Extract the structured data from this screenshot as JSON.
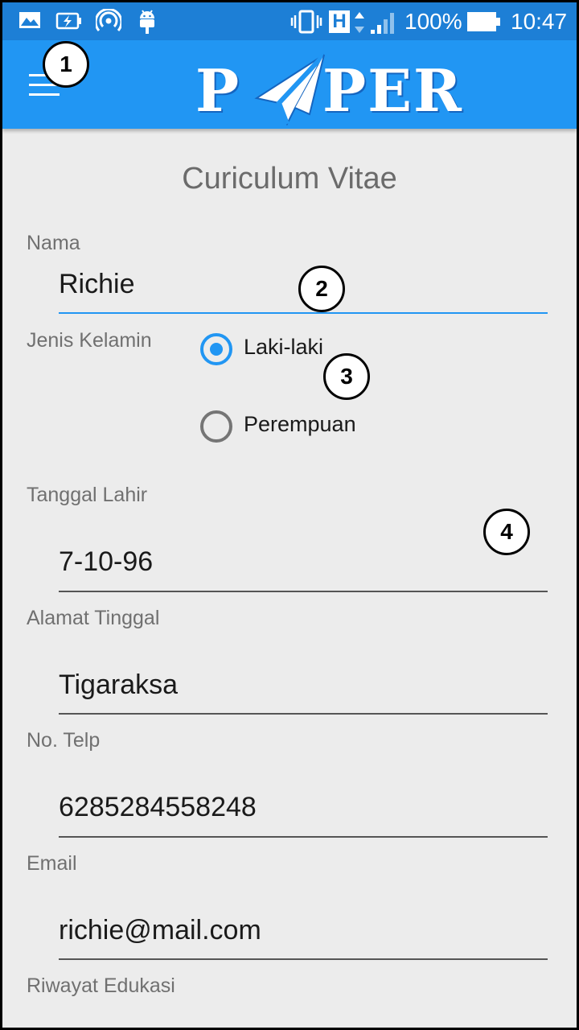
{
  "status_bar": {
    "battery_percent": "100%",
    "time": "10:47",
    "network_type": "H",
    "icons": [
      "image-notification-icon",
      "battery-charging-icon",
      "hotspot-icon",
      "android-icon",
      "vibrate-icon",
      "network-type-icon",
      "signal-icon",
      "battery-icon"
    ]
  },
  "app_bar": {
    "logo_text_left": "P",
    "logo_text_right": "PER",
    "menu_icon": "hamburger-menu-icon",
    "accent_color": "#2196f3"
  },
  "callouts": [
    "1",
    "2",
    "3",
    "4"
  ],
  "form": {
    "title": "Curiculum Vitae",
    "nama": {
      "label": "Nama",
      "value": "Richie"
    },
    "jenis_kelamin": {
      "label": "Jenis Kelamin",
      "options": [
        {
          "label": "Laki-laki",
          "checked": true
        },
        {
          "label": "Perempuan",
          "checked": false
        }
      ]
    },
    "tanggal_lahir": {
      "label": "Tanggal Lahir",
      "value": "7-10-96"
    },
    "alamat": {
      "label": "Alamat Tinggal",
      "value": "Tigaraksa"
    },
    "telp": {
      "label": "No. Telp",
      "value": "6285284558248"
    },
    "email": {
      "label": "Email",
      "value": "richie@mail.com"
    },
    "riwayat": {
      "label": "Riwayat Edukasi"
    }
  }
}
